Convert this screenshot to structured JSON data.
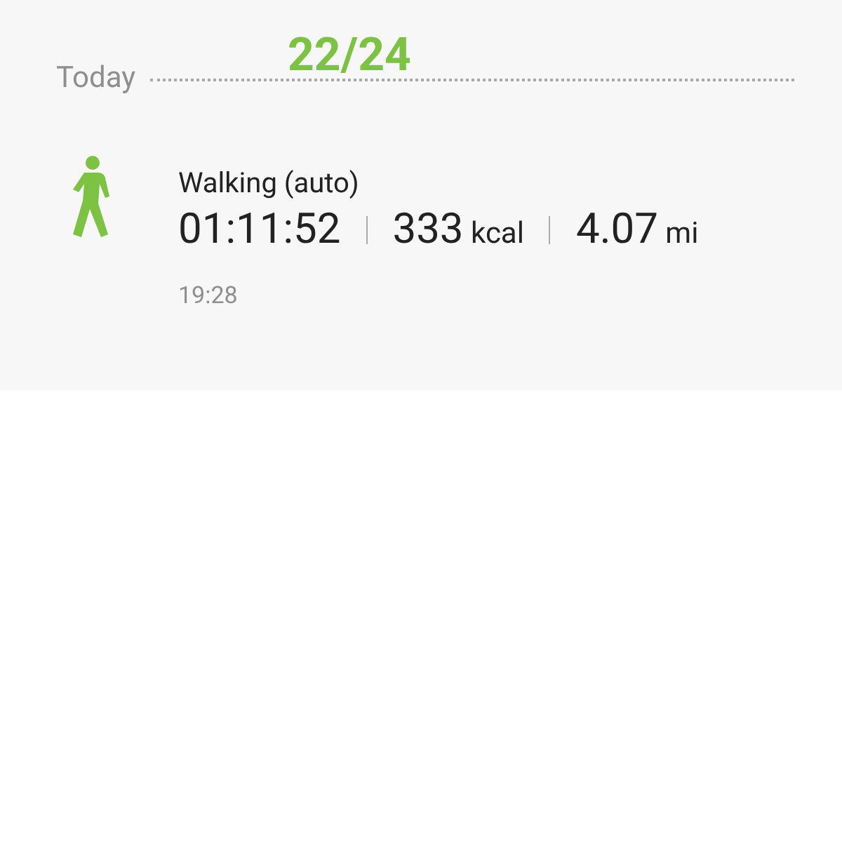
{
  "overlay_counter": "22/24",
  "section": {
    "title": "Today"
  },
  "activity": {
    "name": "Walking (auto)",
    "stats": [
      {
        "value": "01:11:52"
      },
      {
        "value": "333",
        "unit": "kcal"
      },
      {
        "value": "4.07",
        "unit": "mi"
      }
    ],
    "time": "19:28"
  }
}
